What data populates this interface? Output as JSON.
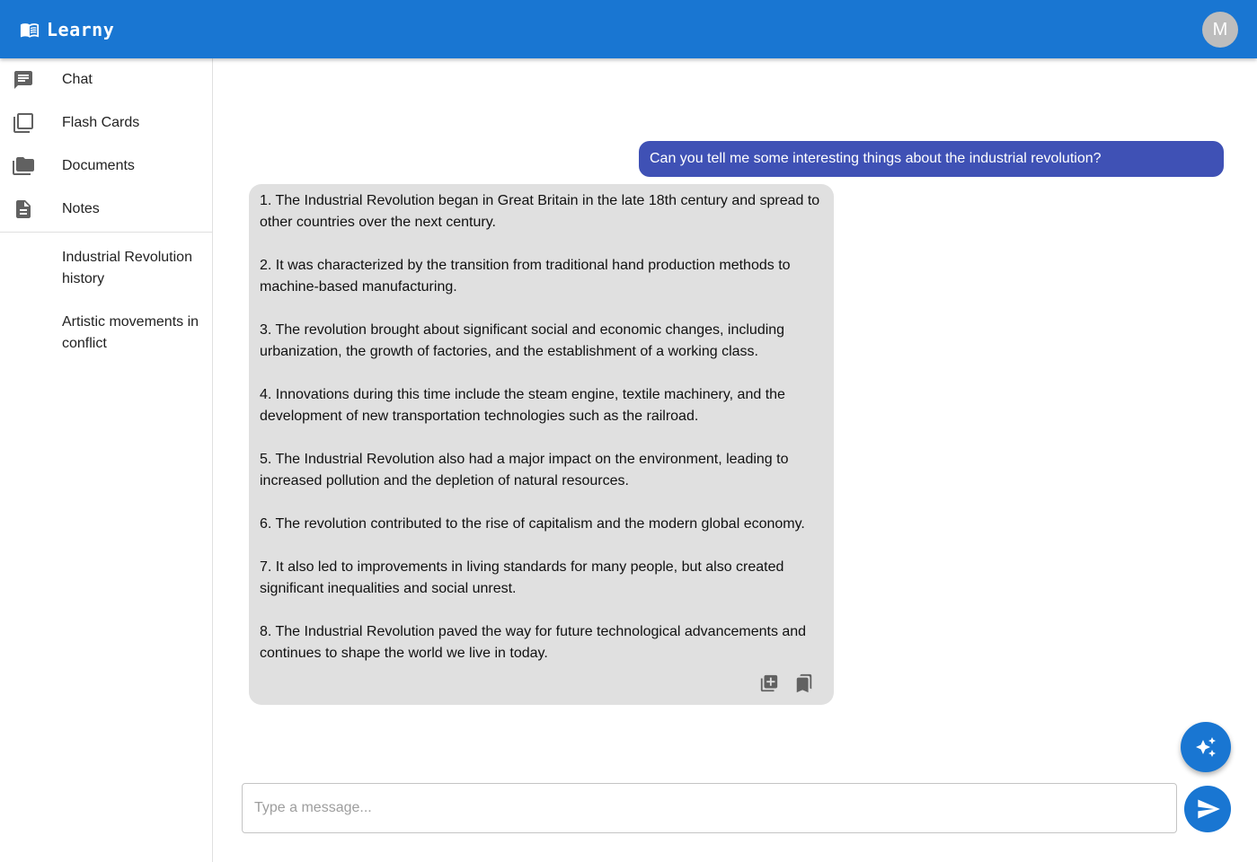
{
  "app": {
    "name": "Learny",
    "avatar_initial": "M",
    "accent": "#1976d2"
  },
  "sidebar": {
    "items": [
      {
        "label": "Chat",
        "icon": "chat-icon"
      },
      {
        "label": "Flash Cards",
        "icon": "flash-cards-icon"
      },
      {
        "label": "Documents",
        "icon": "folder-icon"
      },
      {
        "label": "Notes",
        "icon": "note-icon"
      }
    ],
    "notes": [
      {
        "title": "Industrial Revolution history"
      },
      {
        "title": "Artistic movements in conflict"
      }
    ]
  },
  "chat": {
    "user_message": "Can you tell me some interesting things about the industrial revolution?",
    "user_bubble_color": "#3f51b5",
    "assistant_items": [
      "1. The Industrial Revolution began in Great Britain in the late 18th century and spread to other countries over the next century.",
      "2. It was characterized by the transition from traditional hand production methods to machine-based manufacturing.",
      "3. The revolution brought about significant social and economic changes, including urbanization, the growth of factories, and the establishment of a working class.",
      "4. Innovations during this time include the steam engine, textile machinery, and the development of new transportation technologies such as the railroad.",
      "5. The Industrial Revolution also had a major impact on the environment, leading to increased pollution and the depletion of natural resources.",
      "6. The revolution contributed to the rise of capitalism and the modern global economy.",
      "7. It also led to improvements in living standards for many people, but also created significant inequalities and social unrest.",
      "8. The Industrial Revolution paved the way for future technological advancements and continues to shape the world we live in today."
    ],
    "assistant_actions": [
      "add-to-flashcards-icon",
      "bookmark-icon"
    ]
  },
  "composer": {
    "placeholder": "Type a message...",
    "value": "",
    "ai_button_icon": "sparkle-icon",
    "send_icon": "send-icon"
  }
}
